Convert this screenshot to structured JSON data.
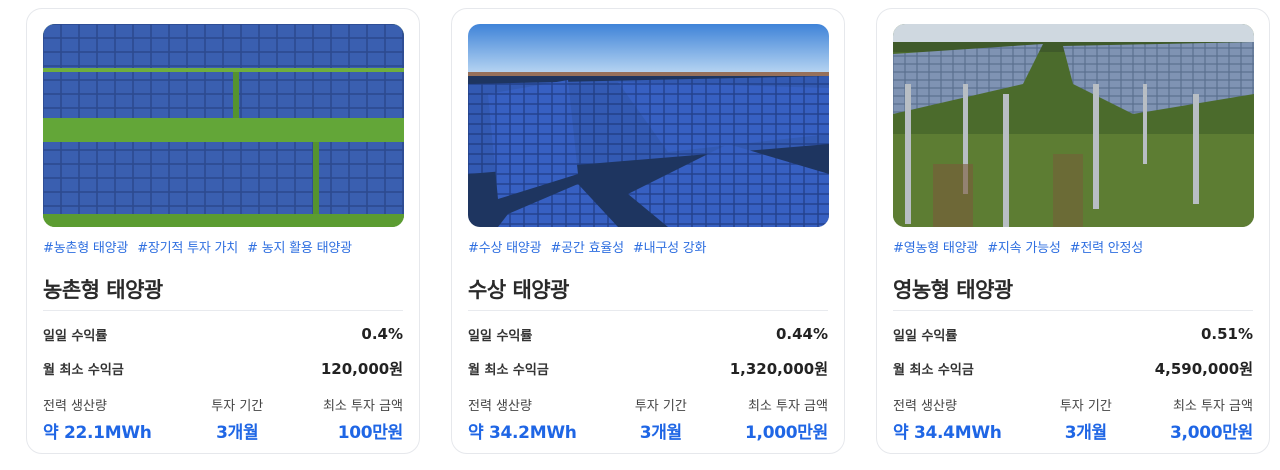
{
  "cards": [
    {
      "image_desc": "farmland-solar-photo",
      "tags": [
        "#농촌형 태양광",
        "#장기적 투자 가치",
        "# 농지 활용 태양광"
      ],
      "title": "농촌형 태양광",
      "daily_rate_label": "일일 수익률",
      "daily_rate": "0.4%",
      "monthly_min_label": "월 최소 수익금",
      "monthly_min": "120,000원",
      "power_label": "전력 생산량",
      "power": "약 22.1MWh",
      "period_label": "투자 기간",
      "period": "3개월",
      "min_invest_label": "최소 투자 금액",
      "min_invest": "100만원"
    },
    {
      "image_desc": "floating-solar-photo",
      "tags": [
        "#수상 태양광",
        "#공간 효율성",
        "#내구성 강화"
      ],
      "title": "수상 태양광",
      "daily_rate_label": "일일 수익률",
      "daily_rate": "0.44%",
      "monthly_min_label": "월 최소 수익금",
      "monthly_min": "1,320,000원",
      "power_label": "전력 생산량",
      "power": "약 34.2MWh",
      "period_label": "투자 기간",
      "period": "3개월",
      "min_invest_label": "최소 투자 금액",
      "min_invest": "1,000만원"
    },
    {
      "image_desc": "agrivoltaic-solar-photo",
      "tags": [
        "#영농형 태양광",
        "#지속 가능성",
        "#전력 안정성"
      ],
      "title": "영농형 태양광",
      "daily_rate_label": "일일 수익률",
      "daily_rate": "0.51%",
      "monthly_min_label": "월 최소 수익금",
      "monthly_min": "4,590,000원",
      "power_label": "전력 생산량",
      "power": "약 34.4MWh",
      "period_label": "투자 기간",
      "period": "3개월",
      "min_invest_label": "최소 투자 금액",
      "min_invest": "3,000만원"
    }
  ],
  "colors": {
    "accent": "#1f66e5",
    "tag": "#2f6fe0",
    "border": "#e6e8ec"
  }
}
